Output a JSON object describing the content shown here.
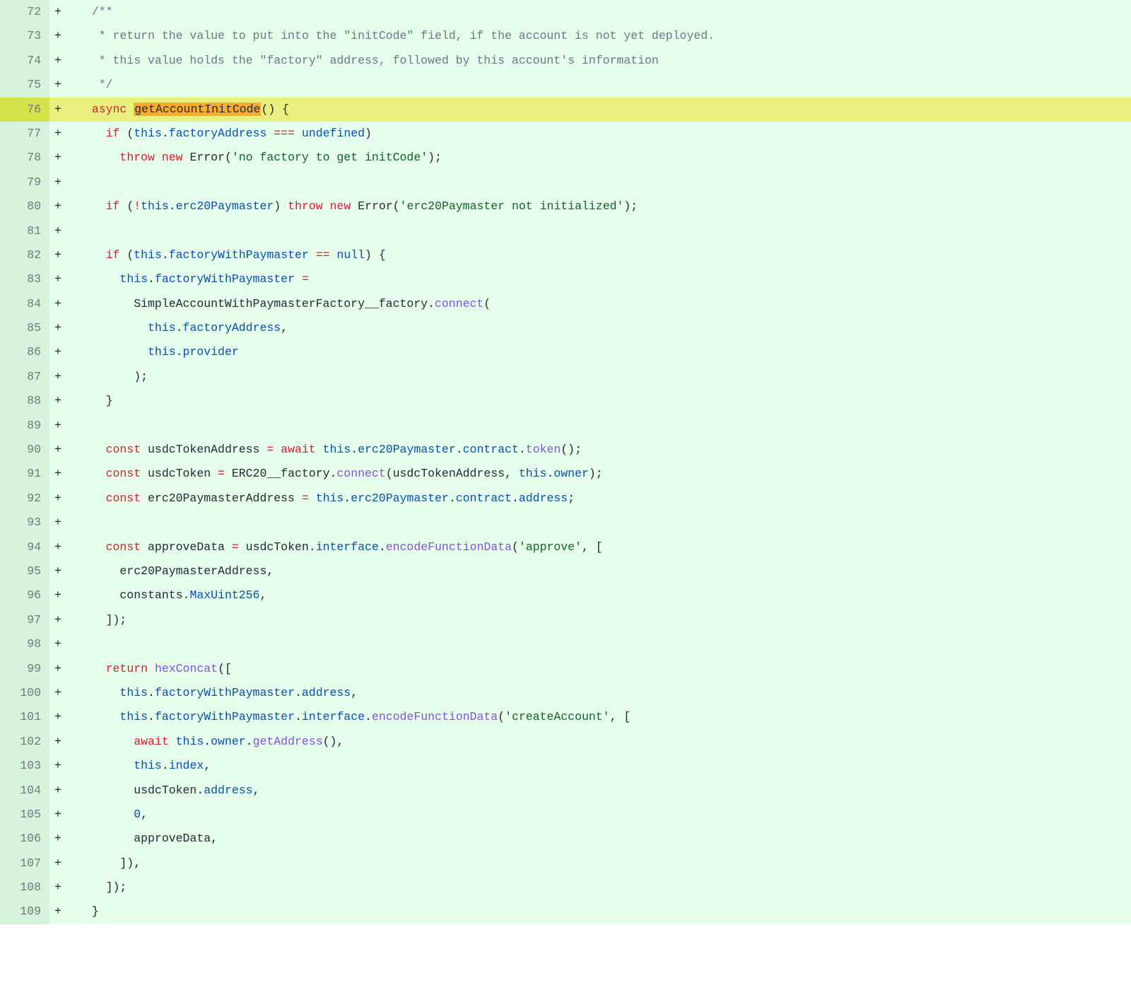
{
  "colors": {
    "addition_bg": "#e6ffec",
    "addition_gutter": "#d8f3dc",
    "highlight_line_bg": "#e9f080",
    "highlight_gutter": "#d4e24a",
    "highlight_word": "#ffab2d"
  },
  "lines": [
    {
      "n": 72,
      "m": "+",
      "hl": false,
      "tokens": [
        {
          "t": "  ",
          "c": ""
        },
        {
          "t": "/**",
          "c": "c-cmt"
        }
      ]
    },
    {
      "n": 73,
      "m": "+",
      "hl": false,
      "tokens": [
        {
          "t": "   * return the value to put into the \"initCode\" field, if the account is not yet deployed.",
          "c": "c-cmt"
        }
      ]
    },
    {
      "n": 74,
      "m": "+",
      "hl": false,
      "tokens": [
        {
          "t": "   * this value holds the \"factory\" address, followed by this account's information",
          "c": "c-cmt"
        }
      ]
    },
    {
      "n": 75,
      "m": "+",
      "hl": false,
      "tokens": [
        {
          "t": "   */",
          "c": "c-cmt"
        }
      ]
    },
    {
      "n": 76,
      "m": "+",
      "hl": true,
      "tokens": [
        {
          "t": "  ",
          "c": ""
        },
        {
          "t": "async",
          "c": "c-kw"
        },
        {
          "t": " ",
          "c": ""
        },
        {
          "t": "getAccountInitCode",
          "c": "hl-word"
        },
        {
          "t": "() {",
          "c": ""
        }
      ]
    },
    {
      "n": 77,
      "m": "+",
      "hl": false,
      "tokens": [
        {
          "t": "    ",
          "c": ""
        },
        {
          "t": "if",
          "c": "c-kw"
        },
        {
          "t": " (",
          "c": ""
        },
        {
          "t": "this",
          "c": "c-prop"
        },
        {
          "t": ".",
          "c": ""
        },
        {
          "t": "factoryAddress",
          "c": "c-prop"
        },
        {
          "t": " ",
          "c": ""
        },
        {
          "t": "===",
          "c": "c-kw"
        },
        {
          "t": " ",
          "c": ""
        },
        {
          "t": "undefined",
          "c": "c-prop"
        },
        {
          "t": ")",
          "c": ""
        }
      ]
    },
    {
      "n": 78,
      "m": "+",
      "hl": false,
      "tokens": [
        {
          "t": "      ",
          "c": ""
        },
        {
          "t": "throw",
          "c": "c-kw"
        },
        {
          "t": " ",
          "c": ""
        },
        {
          "t": "new",
          "c": "c-kw"
        },
        {
          "t": " Error(",
          "c": ""
        },
        {
          "t": "'no factory to get initCode'",
          "c": "c-str"
        },
        {
          "t": ");",
          "c": ""
        }
      ]
    },
    {
      "n": 79,
      "m": "+",
      "hl": false,
      "tokens": [
        {
          "t": "",
          "c": ""
        }
      ]
    },
    {
      "n": 80,
      "m": "+",
      "hl": false,
      "tokens": [
        {
          "t": "    ",
          "c": ""
        },
        {
          "t": "if",
          "c": "c-kw"
        },
        {
          "t": " (",
          "c": ""
        },
        {
          "t": "!",
          "c": "c-kw"
        },
        {
          "t": "this",
          "c": "c-prop"
        },
        {
          "t": ".",
          "c": ""
        },
        {
          "t": "erc20Paymaster",
          "c": "c-prop"
        },
        {
          "t": ") ",
          "c": ""
        },
        {
          "t": "throw",
          "c": "c-kw"
        },
        {
          "t": " ",
          "c": ""
        },
        {
          "t": "new",
          "c": "c-kw"
        },
        {
          "t": " Error(",
          "c": ""
        },
        {
          "t": "'erc20Paymaster not initialized'",
          "c": "c-str"
        },
        {
          "t": ");",
          "c": ""
        }
      ]
    },
    {
      "n": 81,
      "m": "+",
      "hl": false,
      "tokens": [
        {
          "t": "",
          "c": ""
        }
      ]
    },
    {
      "n": 82,
      "m": "+",
      "hl": false,
      "tokens": [
        {
          "t": "    ",
          "c": ""
        },
        {
          "t": "if",
          "c": "c-kw"
        },
        {
          "t": " (",
          "c": ""
        },
        {
          "t": "this",
          "c": "c-prop"
        },
        {
          "t": ".",
          "c": ""
        },
        {
          "t": "factoryWithPaymaster",
          "c": "c-prop"
        },
        {
          "t": " ",
          "c": ""
        },
        {
          "t": "==",
          "c": "c-kw"
        },
        {
          "t": " ",
          "c": ""
        },
        {
          "t": "null",
          "c": "c-prop"
        },
        {
          "t": ") {",
          "c": ""
        }
      ]
    },
    {
      "n": 83,
      "m": "+",
      "hl": false,
      "tokens": [
        {
          "t": "      ",
          "c": ""
        },
        {
          "t": "this",
          "c": "c-prop"
        },
        {
          "t": ".",
          "c": ""
        },
        {
          "t": "factoryWithPaymaster",
          "c": "c-prop"
        },
        {
          "t": " ",
          "c": ""
        },
        {
          "t": "=",
          "c": "c-kw"
        }
      ]
    },
    {
      "n": 84,
      "m": "+",
      "hl": false,
      "tokens": [
        {
          "t": "        SimpleAccountWithPaymasterFactory__factory.",
          "c": ""
        },
        {
          "t": "connect",
          "c": "c-fn"
        },
        {
          "t": "(",
          "c": ""
        }
      ]
    },
    {
      "n": 85,
      "m": "+",
      "hl": false,
      "tokens": [
        {
          "t": "          ",
          "c": ""
        },
        {
          "t": "this",
          "c": "c-prop"
        },
        {
          "t": ".",
          "c": ""
        },
        {
          "t": "factoryAddress",
          "c": "c-prop"
        },
        {
          "t": ",",
          "c": ""
        }
      ]
    },
    {
      "n": 86,
      "m": "+",
      "hl": false,
      "tokens": [
        {
          "t": "          ",
          "c": ""
        },
        {
          "t": "this",
          "c": "c-prop"
        },
        {
          "t": ".",
          "c": ""
        },
        {
          "t": "provider",
          "c": "c-prop"
        }
      ]
    },
    {
      "n": 87,
      "m": "+",
      "hl": false,
      "tokens": [
        {
          "t": "        );",
          "c": ""
        }
      ]
    },
    {
      "n": 88,
      "m": "+",
      "hl": false,
      "tokens": [
        {
          "t": "    }",
          "c": ""
        }
      ]
    },
    {
      "n": 89,
      "m": "+",
      "hl": false,
      "tokens": [
        {
          "t": "",
          "c": ""
        }
      ]
    },
    {
      "n": 90,
      "m": "+",
      "hl": false,
      "tokens": [
        {
          "t": "    ",
          "c": ""
        },
        {
          "t": "const",
          "c": "c-kw"
        },
        {
          "t": " usdcTokenAddress ",
          "c": ""
        },
        {
          "t": "=",
          "c": "c-kw"
        },
        {
          "t": " ",
          "c": ""
        },
        {
          "t": "await",
          "c": "c-kw"
        },
        {
          "t": " ",
          "c": ""
        },
        {
          "t": "this",
          "c": "c-prop"
        },
        {
          "t": ".",
          "c": ""
        },
        {
          "t": "erc20Paymaster",
          "c": "c-prop"
        },
        {
          "t": ".",
          "c": ""
        },
        {
          "t": "contract",
          "c": "c-prop"
        },
        {
          "t": ".",
          "c": ""
        },
        {
          "t": "token",
          "c": "c-fn"
        },
        {
          "t": "();",
          "c": ""
        }
      ]
    },
    {
      "n": 91,
      "m": "+",
      "hl": false,
      "tokens": [
        {
          "t": "    ",
          "c": ""
        },
        {
          "t": "const",
          "c": "c-kw"
        },
        {
          "t": " usdcToken ",
          "c": ""
        },
        {
          "t": "=",
          "c": "c-kw"
        },
        {
          "t": " ERC20__factory.",
          "c": ""
        },
        {
          "t": "connect",
          "c": "c-fn"
        },
        {
          "t": "(usdcTokenAddress, ",
          "c": ""
        },
        {
          "t": "this",
          "c": "c-prop"
        },
        {
          "t": ".",
          "c": ""
        },
        {
          "t": "owner",
          "c": "c-prop"
        },
        {
          "t": ");",
          "c": ""
        }
      ]
    },
    {
      "n": 92,
      "m": "+",
      "hl": false,
      "tokens": [
        {
          "t": "    ",
          "c": ""
        },
        {
          "t": "const",
          "c": "c-kw"
        },
        {
          "t": " erc20PaymasterAddress ",
          "c": ""
        },
        {
          "t": "=",
          "c": "c-kw"
        },
        {
          "t": " ",
          "c": ""
        },
        {
          "t": "this",
          "c": "c-prop"
        },
        {
          "t": ".",
          "c": ""
        },
        {
          "t": "erc20Paymaster",
          "c": "c-prop"
        },
        {
          "t": ".",
          "c": ""
        },
        {
          "t": "contract",
          "c": "c-prop"
        },
        {
          "t": ".",
          "c": ""
        },
        {
          "t": "address",
          "c": "c-prop"
        },
        {
          "t": ";",
          "c": ""
        }
      ]
    },
    {
      "n": 93,
      "m": "+",
      "hl": false,
      "tokens": [
        {
          "t": "",
          "c": ""
        }
      ]
    },
    {
      "n": 94,
      "m": "+",
      "hl": false,
      "tokens": [
        {
          "t": "    ",
          "c": ""
        },
        {
          "t": "const",
          "c": "c-kw"
        },
        {
          "t": " approveData ",
          "c": ""
        },
        {
          "t": "=",
          "c": "c-kw"
        },
        {
          "t": " usdcToken.",
          "c": ""
        },
        {
          "t": "interface",
          "c": "c-prop"
        },
        {
          "t": ".",
          "c": ""
        },
        {
          "t": "encodeFunctionData",
          "c": "c-fn"
        },
        {
          "t": "(",
          "c": ""
        },
        {
          "t": "'approve'",
          "c": "c-str"
        },
        {
          "t": ", [",
          "c": ""
        }
      ]
    },
    {
      "n": 95,
      "m": "+",
      "hl": false,
      "tokens": [
        {
          "t": "      erc20PaymasterAddress,",
          "c": ""
        }
      ]
    },
    {
      "n": 96,
      "m": "+",
      "hl": false,
      "tokens": [
        {
          "t": "      constants.",
          "c": ""
        },
        {
          "t": "MaxUint256",
          "c": "c-prop"
        },
        {
          "t": ",",
          "c": ""
        }
      ]
    },
    {
      "n": 97,
      "m": "+",
      "hl": false,
      "tokens": [
        {
          "t": "    ]);",
          "c": ""
        }
      ]
    },
    {
      "n": 98,
      "m": "+",
      "hl": false,
      "tokens": [
        {
          "t": "",
          "c": ""
        }
      ]
    },
    {
      "n": 99,
      "m": "+",
      "hl": false,
      "tokens": [
        {
          "t": "    ",
          "c": ""
        },
        {
          "t": "return",
          "c": "c-kw"
        },
        {
          "t": " ",
          "c": ""
        },
        {
          "t": "hexConcat",
          "c": "c-fn"
        },
        {
          "t": "([",
          "c": ""
        }
      ]
    },
    {
      "n": 100,
      "m": "+",
      "hl": false,
      "tokens": [
        {
          "t": "      ",
          "c": ""
        },
        {
          "t": "this",
          "c": "c-prop"
        },
        {
          "t": ".",
          "c": ""
        },
        {
          "t": "factoryWithPaymaster",
          "c": "c-prop"
        },
        {
          "t": ".",
          "c": ""
        },
        {
          "t": "address",
          "c": "c-prop"
        },
        {
          "t": ",",
          "c": ""
        }
      ]
    },
    {
      "n": 101,
      "m": "+",
      "hl": false,
      "tokens": [
        {
          "t": "      ",
          "c": ""
        },
        {
          "t": "this",
          "c": "c-prop"
        },
        {
          "t": ".",
          "c": ""
        },
        {
          "t": "factoryWithPaymaster",
          "c": "c-prop"
        },
        {
          "t": ".",
          "c": ""
        },
        {
          "t": "interface",
          "c": "c-prop"
        },
        {
          "t": ".",
          "c": ""
        },
        {
          "t": "encodeFunctionData",
          "c": "c-fn"
        },
        {
          "t": "(",
          "c": ""
        },
        {
          "t": "'createAccount'",
          "c": "c-str"
        },
        {
          "t": ", [",
          "c": ""
        }
      ]
    },
    {
      "n": 102,
      "m": "+",
      "hl": false,
      "tokens": [
        {
          "t": "        ",
          "c": ""
        },
        {
          "t": "await",
          "c": "c-kw"
        },
        {
          "t": " ",
          "c": ""
        },
        {
          "t": "this",
          "c": "c-prop"
        },
        {
          "t": ".",
          "c": ""
        },
        {
          "t": "owner",
          "c": "c-prop"
        },
        {
          "t": ".",
          "c": ""
        },
        {
          "t": "getAddress",
          "c": "c-fn"
        },
        {
          "t": "(),",
          "c": ""
        }
      ]
    },
    {
      "n": 103,
      "m": "+",
      "hl": false,
      "tokens": [
        {
          "t": "        ",
          "c": ""
        },
        {
          "t": "this",
          "c": "c-prop"
        },
        {
          "t": ".",
          "c": ""
        },
        {
          "t": "index",
          "c": "c-prop"
        },
        {
          "t": ",",
          "c": ""
        }
      ]
    },
    {
      "n": 104,
      "m": "+",
      "hl": false,
      "tokens": [
        {
          "t": "        usdcToken.",
          "c": ""
        },
        {
          "t": "address",
          "c": "c-prop"
        },
        {
          "t": ",",
          "c": ""
        }
      ]
    },
    {
      "n": 105,
      "m": "+",
      "hl": false,
      "tokens": [
        {
          "t": "        ",
          "c": ""
        },
        {
          "t": "0",
          "c": "c-num"
        },
        {
          "t": ",",
          "c": ""
        }
      ]
    },
    {
      "n": 106,
      "m": "+",
      "hl": false,
      "tokens": [
        {
          "t": "        approveData,",
          "c": ""
        }
      ]
    },
    {
      "n": 107,
      "m": "+",
      "hl": false,
      "tokens": [
        {
          "t": "      ]),",
          "c": ""
        }
      ]
    },
    {
      "n": 108,
      "m": "+",
      "hl": false,
      "tokens": [
        {
          "t": "    ]);",
          "c": ""
        }
      ]
    },
    {
      "n": 109,
      "m": "+",
      "hl": false,
      "tokens": [
        {
          "t": "  }",
          "c": ""
        }
      ]
    }
  ]
}
